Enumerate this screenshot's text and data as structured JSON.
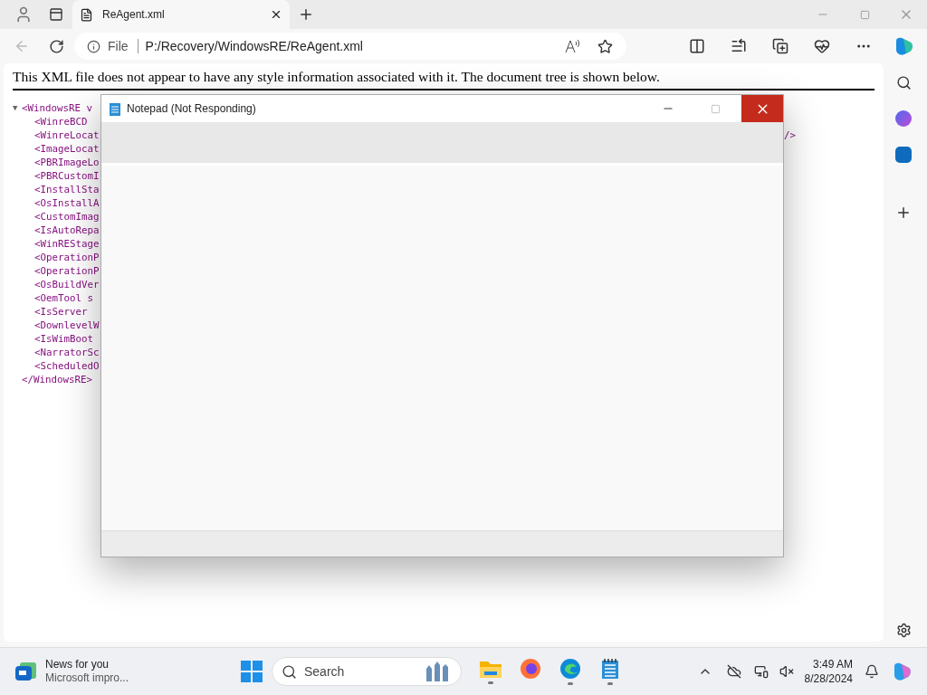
{
  "browser": {
    "tabs": [
      {
        "label": "ReAgent.xml",
        "selected": true
      }
    ],
    "address": {
      "scheme": "File",
      "url": "P:/Recovery/WindowsRE/ReAgent.xml"
    }
  },
  "page": {
    "notice": "This XML file does not appear to have any style information associated with it. The document tree is shown below.",
    "xml_tree": {
      "open_tag": "<WindowsRE v",
      "toggle": "▼",
      "expanded": true,
      "close_tag": "</WindowsRE>",
      "children": [
        {
          "text": "<WinreBCD"
        },
        {
          "text": "<WinreLocat",
          "tail": "/>"
        },
        {
          "text": "<ImageLocat"
        },
        {
          "text": "<PBRImageLo"
        },
        {
          "text": "<PBRCustomI"
        },
        {
          "text": "<InstallSta"
        },
        {
          "text": "<OsInstallA"
        },
        {
          "text": "<CustomImag"
        },
        {
          "text": "<IsAutoRepa"
        },
        {
          "text": "<WinREStage"
        },
        {
          "text": "<OperationP"
        },
        {
          "text": "<OperationP"
        },
        {
          "text": "<OsBuildVer"
        },
        {
          "text": "<OemTool s"
        },
        {
          "text": "<IsServer"
        },
        {
          "text": "<DownlevelW"
        },
        {
          "text": "<IsWimBoot"
        },
        {
          "text": "<NarratorSc"
        },
        {
          "text": "<ScheduledO"
        }
      ]
    }
  },
  "notepad": {
    "title": "Notepad (Not Responding)"
  },
  "taskbar": {
    "news": {
      "title": "News for you",
      "subtitle": "Microsoft impro..."
    },
    "search": "Search",
    "apps": [
      {
        "kind": "explorer",
        "running": true
      },
      {
        "kind": "firefox",
        "running": false
      },
      {
        "kind": "edge",
        "running": true
      },
      {
        "kind": "notepad",
        "running": true
      }
    ],
    "time": "3:49 AM",
    "date": "8/28/2024"
  }
}
